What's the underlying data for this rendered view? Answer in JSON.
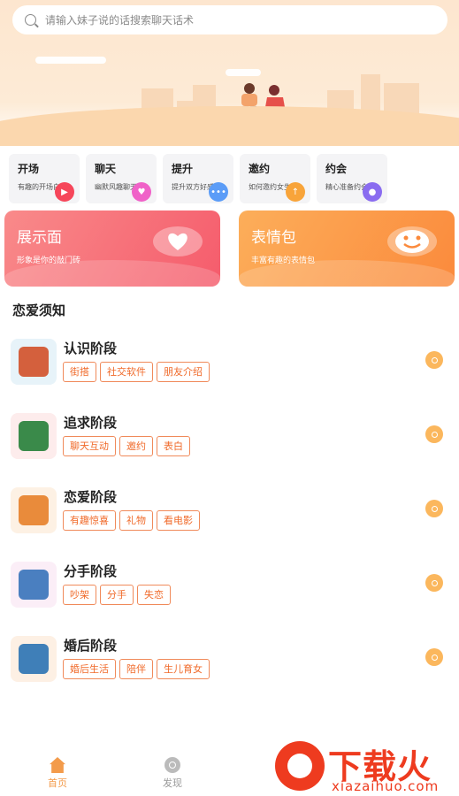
{
  "search": {
    "placeholder": "请输入妹子说的话搜索聊天话术"
  },
  "categories": [
    {
      "title": "开场",
      "sub": "有趣的开场白",
      "badge_color": "#f6465a",
      "icon": "play-icon"
    },
    {
      "title": "聊天",
      "sub": "幽默风趣聊天",
      "badge_color": "#f062c8",
      "icon": "heart-icon"
    },
    {
      "title": "提升",
      "sub": "提升双方好感",
      "badge_color": "#5b9cf7",
      "icon": "more-icon"
    },
    {
      "title": "邀约",
      "sub": "如何邀约女生",
      "badge_color": "#f8a43a",
      "icon": "up-arrow-icon"
    },
    {
      "title": "约会",
      "sub": "精心准备约会",
      "badge_color": "#8a6cf0",
      "icon": "person-icon"
    }
  ],
  "banners": [
    {
      "title": "展示面",
      "sub": "形象是你的敲门砖",
      "color_from": "#f98a8a",
      "color_to": "#f55c6c",
      "icon": "heart-icon"
    },
    {
      "title": "表情包",
      "sub": "丰富有趣的表情包",
      "color_from": "#fcae5a",
      "color_to": "#fb8a3c",
      "icon": "smile-icon"
    }
  ],
  "section_title": "恋爱须知",
  "stages": [
    {
      "title": "认识阶段",
      "tags": [
        "街搭",
        "社交软件",
        "朋友介绍"
      ],
      "thumb_color": "#e7f3f9"
    },
    {
      "title": "追求阶段",
      "tags": [
        "聊天互动",
        "邀约",
        "表白"
      ],
      "thumb_color": "#fdecec"
    },
    {
      "title": "恋爱阶段",
      "tags": [
        "有趣惊喜",
        "礼物",
        "看电影"
      ],
      "thumb_color": "#fdf1e4"
    },
    {
      "title": "分手阶段",
      "tags": [
        "吵架",
        "分手",
        "失恋"
      ],
      "thumb_color": "#fbeef7"
    },
    {
      "title": "婚后阶段",
      "tags": [
        "婚后生活",
        "陪伴",
        "生儿育女"
      ],
      "thumb_color": "#fdf0e4"
    }
  ],
  "nav": {
    "home": "首页",
    "discover": "发现"
  },
  "watermark": {
    "text": "下载火",
    "url": "xiazaihuo.com"
  },
  "colors": {
    "accent": "#f06a2a",
    "tag_border": "#f08a5a",
    "go_button": "#fbb75d"
  }
}
